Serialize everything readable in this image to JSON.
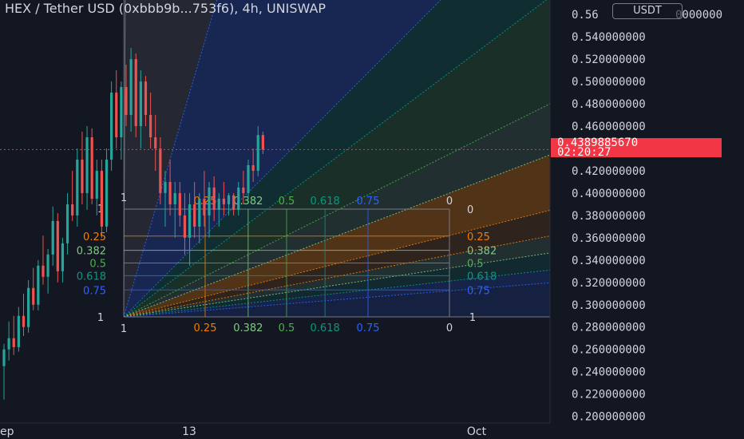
{
  "header": {
    "title": "HEX / Tether USD (0xbbb9b...753f6), 4h, UNISWAP",
    "currency_badge": "USDT"
  },
  "price_tag": {
    "price": "0.4389885670",
    "countdown": "02:20:27"
  },
  "colors": {
    "background": "#131722",
    "up": "#26a69a",
    "down": "#ef5350",
    "price_tag": "#f23645"
  },
  "chart_data": {
    "type": "candlestick",
    "timeframe": "4h",
    "y_axis": {
      "ticks": [
        "0.200000000",
        "0.220000000",
        "0.240000000",
        "0.260000000",
        "0.280000000",
        "0.300000000",
        "0.320000000",
        "0.340000000",
        "0.360000000",
        "0.380000000",
        "0.400000000",
        "0.420000000",
        "0.440000000",
        "0.460000000",
        "0.480000000",
        "0.500000000",
        "0.520000000",
        "0.540000000",
        "0.56"
      ],
      "top_label_tail": "0000000",
      "range": [
        0.194,
        0.573
      ]
    },
    "x_axis": {
      "ticks": [
        "ep",
        "13",
        "Oct"
      ]
    },
    "last_price": 0.439,
    "candles_ohlc": [
      [
        0.245,
        0.265,
        0.215,
        0.26
      ],
      [
        0.26,
        0.285,
        0.25,
        0.27
      ],
      [
        0.27,
        0.29,
        0.255,
        0.262
      ],
      [
        0.262,
        0.298,
        0.258,
        0.29
      ],
      [
        0.29,
        0.31,
        0.272,
        0.28
      ],
      [
        0.28,
        0.322,
        0.275,
        0.315
      ],
      [
        0.315,
        0.333,
        0.295,
        0.3
      ],
      [
        0.3,
        0.34,
        0.295,
        0.335
      ],
      [
        0.335,
        0.362,
        0.318,
        0.325
      ],
      [
        0.325,
        0.35,
        0.31,
        0.345
      ],
      [
        0.345,
        0.388,
        0.335,
        0.375
      ],
      [
        0.375,
        0.382,
        0.32,
        0.33
      ],
      [
        0.33,
        0.36,
        0.32,
        0.355
      ],
      [
        0.355,
        0.4,
        0.345,
        0.39
      ],
      [
        0.39,
        0.42,
        0.375,
        0.38
      ],
      [
        0.38,
        0.44,
        0.37,
        0.43
      ],
      [
        0.43,
        0.455,
        0.39,
        0.4
      ],
      [
        0.4,
        0.46,
        0.385,
        0.45
      ],
      [
        0.45,
        0.458,
        0.39,
        0.395
      ],
      [
        0.395,
        0.43,
        0.38,
        0.42
      ],
      [
        0.42,
        0.43,
        0.36,
        0.37
      ],
      [
        0.37,
        0.44,
        0.365,
        0.43
      ],
      [
        0.43,
        0.5,
        0.42,
        0.49
      ],
      [
        0.49,
        0.51,
        0.44,
        0.45
      ],
      [
        0.45,
        0.5,
        0.43,
        0.495
      ],
      [
        0.495,
        0.515,
        0.46,
        0.47
      ],
      [
        0.47,
        0.53,
        0.455,
        0.52
      ],
      [
        0.52,
        0.525,
        0.45,
        0.46
      ],
      [
        0.46,
        0.51,
        0.44,
        0.5
      ],
      [
        0.5,
        0.505,
        0.46,
        0.47
      ],
      [
        0.47,
        0.49,
        0.44,
        0.45
      ],
      [
        0.45,
        0.47,
        0.42,
        0.44
      ],
      [
        0.44,
        0.45,
        0.39,
        0.4
      ],
      [
        0.4,
        0.42,
        0.37,
        0.41
      ],
      [
        0.41,
        0.43,
        0.38,
        0.39
      ],
      [
        0.39,
        0.41,
        0.36,
        0.4
      ],
      [
        0.4,
        0.41,
        0.37,
        0.38
      ],
      [
        0.38,
        0.4,
        0.345,
        0.36
      ],
      [
        0.36,
        0.4,
        0.335,
        0.39
      ],
      [
        0.39,
        0.41,
        0.36,
        0.37
      ],
      [
        0.37,
        0.4,
        0.355,
        0.395
      ],
      [
        0.395,
        0.42,
        0.37,
        0.38
      ],
      [
        0.38,
        0.41,
        0.36,
        0.405
      ],
      [
        0.405,
        0.415,
        0.375,
        0.385
      ],
      [
        0.385,
        0.4,
        0.37,
        0.395
      ],
      [
        0.395,
        0.41,
        0.38,
        0.39
      ],
      [
        0.39,
        0.4,
        0.38,
        0.398
      ],
      [
        0.398,
        0.4,
        0.38,
        0.385
      ],
      [
        0.385,
        0.41,
        0.38,
        0.405
      ],
      [
        0.405,
        0.42,
        0.39,
        0.4
      ],
      [
        0.4,
        0.43,
        0.395,
        0.425
      ],
      [
        0.425,
        0.44,
        0.41,
        0.42
      ],
      [
        0.42,
        0.46,
        0.415,
        0.452
      ],
      [
        0.452,
        0.455,
        0.435,
        0.439
      ]
    ],
    "gann_fan": {
      "levels": [
        "0",
        "0.25",
        "0.382",
        "0.5",
        "0.618",
        "0.75",
        "1"
      ],
      "corner_labels": [
        "1",
        "1",
        "1",
        "1",
        "1"
      ],
      "colors": [
        "#787b86",
        "#f57c00",
        "#81c784",
        "#4caf50",
        "#089981",
        "#2962ff",
        "#787b86"
      ]
    }
  }
}
